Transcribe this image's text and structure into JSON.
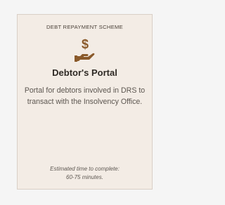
{
  "card": {
    "scheme_label": "DEBT REPAYMENT SCHEME",
    "icon": "hand-holding-dollar-icon",
    "title": "Debtor's Portal",
    "description": "Portal for debtors involved in DRS to transact with the Insolvency Office.",
    "estimate_line1": "Estimated time to complete:",
    "estimate_line2": "60-75 minutes."
  },
  "colors": {
    "card_background": "#f3ece5",
    "icon_brown": "#8a5a2b"
  }
}
